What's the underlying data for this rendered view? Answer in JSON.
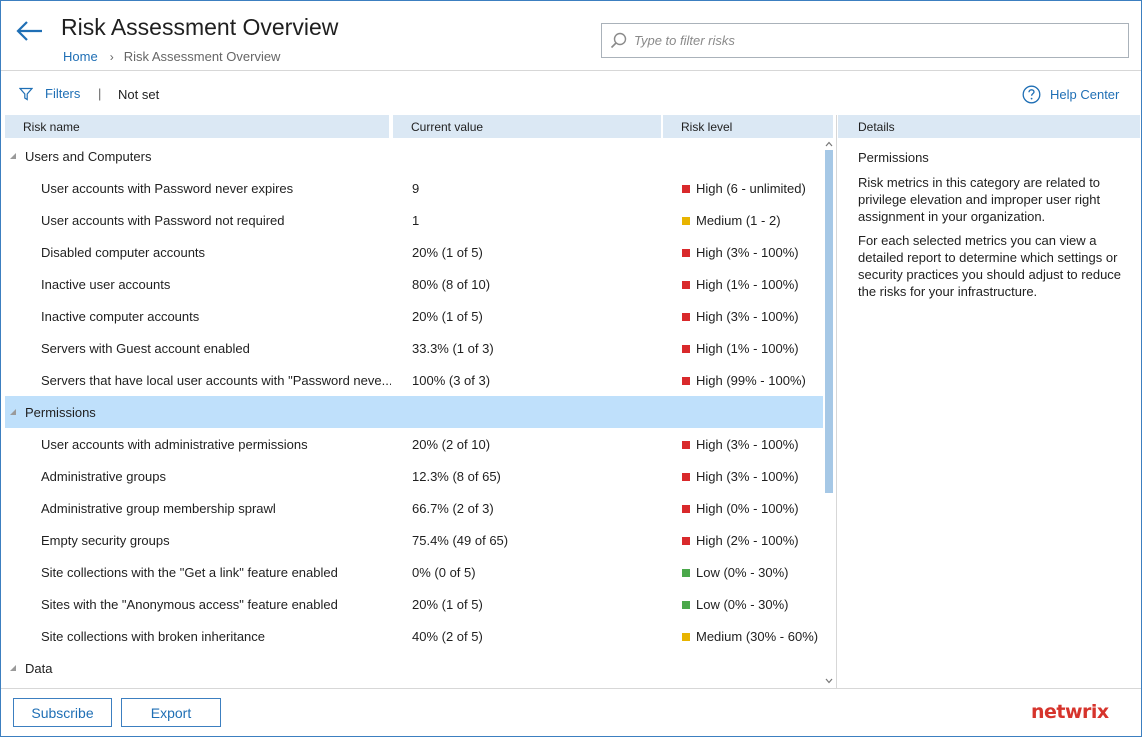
{
  "header": {
    "title": "Risk Assessment Overview",
    "breadcrumb_home": "Home",
    "breadcrumb_sep": "›",
    "breadcrumb_current": "Risk Assessment Overview",
    "search_placeholder": "Type to filter risks",
    "search_value": ""
  },
  "toolbar": {
    "filters_label": "Filters",
    "divider": "|",
    "filter_state": "Not set",
    "help_label": "Help Center"
  },
  "grid": {
    "columns": [
      "Risk name",
      "Current value",
      "Risk level"
    ],
    "groups": [
      {
        "name": "Users and Computers",
        "selected": false
      },
      {
        "name": "Permissions",
        "selected": true
      },
      {
        "name": "Data",
        "selected": false
      }
    ],
    "rows": [
      {
        "name": "User accounts with Password never expires",
        "value": "9",
        "level": "High (6 - unlimited)",
        "color": "#d9292b"
      },
      {
        "name": "User accounts with Password not required",
        "value": "1",
        "level": "Medium (1 - 2)",
        "color": "#e8b400"
      },
      {
        "name": "Disabled computer accounts",
        "value": "20% (1 of 5)",
        "level": "High (3% - 100%)",
        "color": "#d9292b"
      },
      {
        "name": "Inactive user accounts",
        "value": "80% (8 of 10)",
        "level": "High (1% - 100%)",
        "color": "#d9292b"
      },
      {
        "name": "Inactive computer accounts",
        "value": "20% (1 of 5)",
        "level": "High (3% - 100%)",
        "color": "#d9292b"
      },
      {
        "name": "Servers with Guest account enabled",
        "value": "33.3% (1 of 3)",
        "level": "High (1% - 100%)",
        "color": "#d9292b"
      },
      {
        "name": "Servers that have local user accounts with \"Password neve...",
        "value": "100% (3 of 3)",
        "level": "High (99% - 100%)",
        "color": "#d9292b"
      },
      {
        "name": "User accounts with administrative permissions",
        "value": "20% (2 of 10)",
        "level": "High (3% - 100%)",
        "color": "#d9292b"
      },
      {
        "name": "Administrative groups",
        "value": "12.3% (8 of 65)",
        "level": "High (3% - 100%)",
        "color": "#d9292b"
      },
      {
        "name": "Administrative group membership sprawl",
        "value": "66.7% (2 of 3)",
        "level": "High (0% - 100%)",
        "color": "#d9292b"
      },
      {
        "name": "Empty security groups",
        "value": "75.4% (49 of 65)",
        "level": "High (2% - 100%)",
        "color": "#d9292b"
      },
      {
        "name": "Site collections with the \"Get a link\" feature enabled",
        "value": "0% (0 of 5)",
        "level": "Low (0% - 30%)",
        "color": "#4aa84a"
      },
      {
        "name": "Sites with the \"Anonymous access\" feature enabled",
        "value": "20% (1 of 5)",
        "level": "Low (0% - 30%)",
        "color": "#4aa84a"
      },
      {
        "name": "Site collections with broken inheritance",
        "value": "40% (2 of 5)",
        "level": "Medium (30% - 60%)",
        "color": "#e8b400"
      }
    ]
  },
  "details": {
    "header": "Details",
    "title": "Permissions",
    "paragraph1": "Risk metrics in this category are related to privilege elevation and improper user right assignment in your organization.",
    "paragraph2": "For each selected metrics you can view a detailed report to determine which settings or security practices you should adjust to reduce the risks for your infrastructure."
  },
  "footer": {
    "subscribe_label": "Subscribe",
    "export_label": "Export",
    "logo_text": "netwrix"
  },
  "colors": {
    "accent": "#1f6fb5",
    "header_bg": "#dbe8f4",
    "selected_bg": "#bfe0fb",
    "logo": "#d6342c"
  }
}
